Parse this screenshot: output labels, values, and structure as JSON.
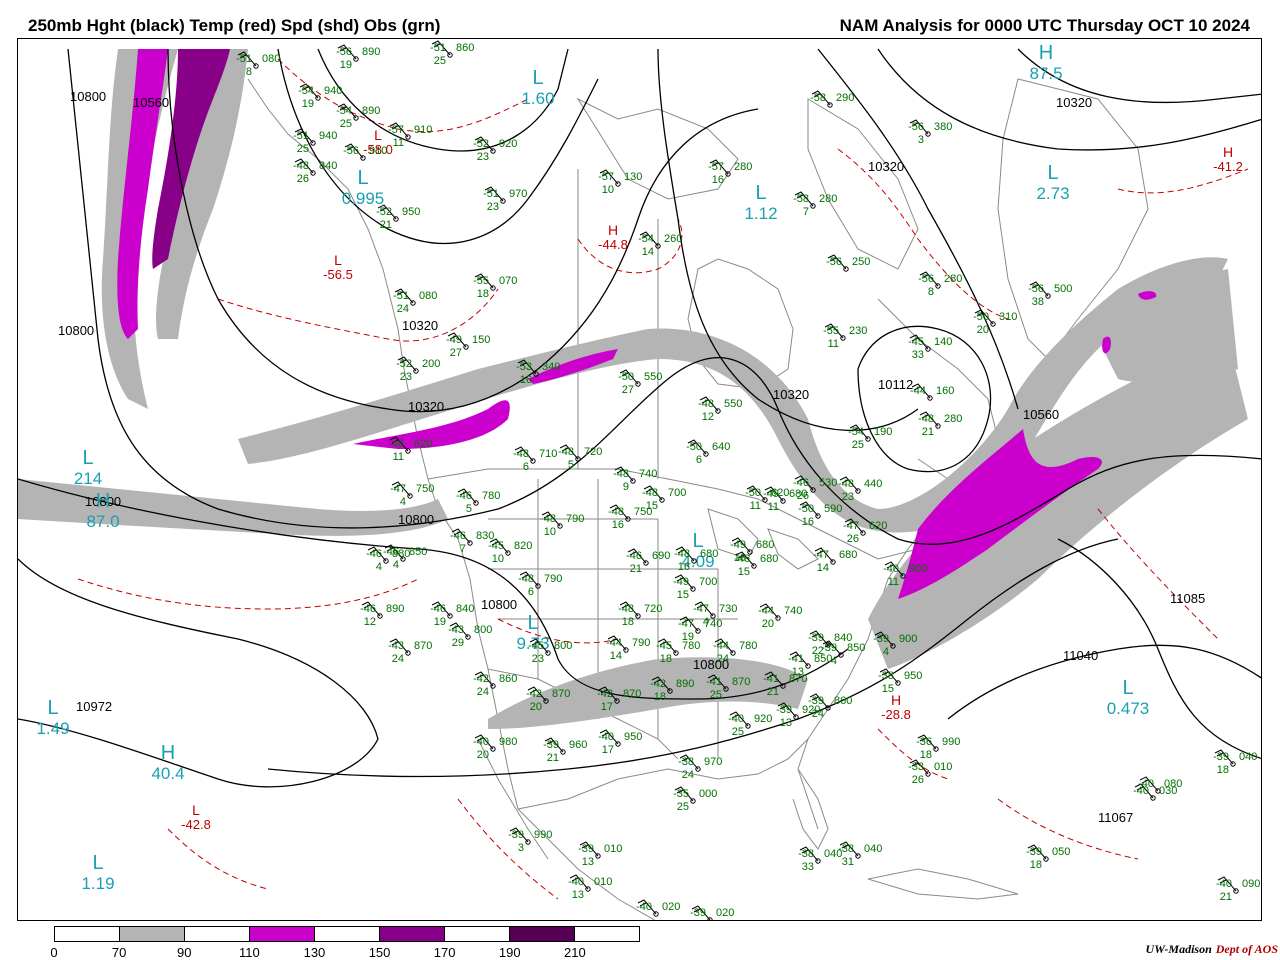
{
  "header": {
    "title_left": "250mb Hght (black) Temp (red) Spd (shd) Obs (grn)",
    "title_right": "NAM Analysis for 0000 UTC Thursday  OCT 10 2024"
  },
  "colors": {
    "height_contour": "#000000",
    "temperature_contour": "#c00000",
    "observations": "#007000",
    "pressure_centers": "#1aa0b0",
    "geography": "#888888",
    "speed_70_90": "#b4b4b4",
    "speed_110_130": "#cc00cc",
    "speed_150_170": "#880088",
    "speed_190_210": "#550055"
  },
  "legend": {
    "ticks": [
      "0",
      "70",
      "90",
      "110",
      "130",
      "150",
      "170",
      "190",
      "210"
    ],
    "fills": [
      "#ffffff",
      "#b4b4b4",
      "#ffffff",
      "#cc00cc",
      "#ffffff",
      "#880088",
      "#ffffff",
      "#550055",
      "#ffffff"
    ]
  },
  "credit": {
    "org": "UW-Madison",
    "dept": "Dept of AOS"
  },
  "height_labels": [
    {
      "text": "10800"
    },
    {
      "text": "10560"
    },
    {
      "text": "10800"
    },
    {
      "text": "10800"
    },
    {
      "text": "10320"
    },
    {
      "text": "10320"
    },
    {
      "text": "10320"
    },
    {
      "text": "10800"
    },
    {
      "text": "10320"
    },
    {
      "text": "10560"
    },
    {
      "text": "10800"
    },
    {
      "text": "10800"
    },
    {
      "text": "11040"
    },
    {
      "text": "10972"
    },
    {
      "text": "10112"
    },
    {
      "text": "11085"
    },
    {
      "text": "11067"
    },
    {
      "text": "10320"
    }
  ],
  "pressure_centers": [
    {
      "letter": "L",
      "value": "1.60"
    },
    {
      "letter": "L",
      "value": "0.995"
    },
    {
      "letter": "L",
      "value": "1.12"
    },
    {
      "letter": "L",
      "value": "2.73"
    },
    {
      "letter": "H",
      "value": "87.5"
    },
    {
      "letter": "L",
      "value": "214"
    },
    {
      "letter": "H",
      "value": "87.0"
    },
    {
      "letter": "L",
      "value": "4.09"
    },
    {
      "letter": "L",
      "value": "0.473"
    },
    {
      "letter": "H",
      "value": "40.4"
    },
    {
      "letter": "L",
      "value": "1.49"
    },
    {
      "letter": "L",
      "value": "1.19"
    },
    {
      "letter": "L",
      "value": "9.73"
    }
  ],
  "temperature_centers": [
    {
      "letter": "L",
      "value": "-56.5"
    },
    {
      "letter": "H",
      "value": "-44.8"
    },
    {
      "letter": "H",
      "value": "-41.2"
    },
    {
      "letter": "L",
      "value": "-42.8"
    },
    {
      "letter": "H",
      "value": "-28.8"
    },
    {
      "letter": "L",
      "value": "-58.0"
    }
  ],
  "observations": [
    {
      "t": "-56",
      "h": "890",
      "d": "19"
    },
    {
      "t": "-51",
      "h": "860",
      "d": "25"
    },
    {
      "t": "-51",
      "h": "080",
      "d": "8"
    },
    {
      "t": "-54",
      "h": "940",
      "d": "19"
    },
    {
      "t": "-54",
      "h": "890",
      "d": "25"
    },
    {
      "t": "-57",
      "h": "910",
      "d": "11"
    },
    {
      "t": "-51",
      "h": "940",
      "d": "25"
    },
    {
      "t": "-52",
      "h": "920",
      "d": "23"
    },
    {
      "t": "-56",
      "h": "910",
      "d": ""
    },
    {
      "t": "-48",
      "h": "840",
      "d": "26"
    },
    {
      "t": "-51",
      "h": "970",
      "d": "23"
    },
    {
      "t": "-57",
      "h": "130",
      "d": "10"
    },
    {
      "t": "-57",
      "h": "280",
      "d": "16"
    },
    {
      "t": "-58",
      "h": "290",
      "d": ""
    },
    {
      "t": "-56",
      "h": "380",
      "d": "3"
    },
    {
      "t": "-52",
      "h": "950",
      "d": "21"
    },
    {
      "t": "-58",
      "h": "280",
      "d": "7"
    },
    {
      "t": "-54",
      "h": "260",
      "d": "14"
    },
    {
      "t": "-56",
      "h": "250",
      "d": ""
    },
    {
      "t": "-55",
      "h": "070",
      "d": "18"
    },
    {
      "t": "-51",
      "h": "080",
      "d": "24"
    },
    {
      "t": "-56",
      "h": "280",
      "d": "8"
    },
    {
      "t": "-56",
      "h": "500",
      "d": "38"
    },
    {
      "t": "-50",
      "h": "310",
      "d": "20"
    },
    {
      "t": "-55",
      "h": "230",
      "d": "11"
    },
    {
      "t": "-45",
      "h": "140",
      "d": "33"
    },
    {
      "t": "-49",
      "h": "150",
      "d": "27"
    },
    {
      "t": "-52",
      "h": "200",
      "d": "23"
    },
    {
      "t": "-53",
      "h": "340",
      "d": "16"
    },
    {
      "t": "-50",
      "h": "550",
      "d": "27"
    },
    {
      "t": "-44",
      "h": "160",
      "d": ""
    },
    {
      "t": "-48",
      "h": "550",
      "d": "12"
    },
    {
      "t": "-48",
      "h": "280",
      "d": "21"
    },
    {
      "t": "-54",
      "h": "190",
      "d": "25"
    },
    {
      "t": "-48",
      "h": "620",
      "d": "11"
    },
    {
      "t": "-48",
      "h": "710",
      "d": "6"
    },
    {
      "t": "-48",
      "h": "720",
      "d": "5"
    },
    {
      "t": "-50",
      "h": "640",
      "d": "6"
    },
    {
      "t": "-48",
      "h": "740",
      "d": "9"
    },
    {
      "t": "-49",
      "h": "680",
      "d": "11"
    },
    {
      "t": "-47",
      "h": "750",
      "d": "4"
    },
    {
      "t": "-46",
      "h": "780",
      "d": "5"
    },
    {
      "t": "-48",
      "h": "700",
      "d": "15"
    },
    {
      "t": "-50",
      "h": "620",
      "d": "11"
    },
    {
      "t": "-46",
      "h": "530",
      "d": "26"
    },
    {
      "t": "-48",
      "h": "440",
      "d": "23"
    },
    {
      "t": "-50",
      "h": "590",
      "d": "16"
    },
    {
      "t": "-47",
      "h": "620",
      "d": "26"
    },
    {
      "t": "-48",
      "h": "790",
      "d": "10"
    },
    {
      "t": "-48",
      "h": "750",
      "d": "16"
    },
    {
      "t": "-46",
      "h": "850",
      "d": "4"
    },
    {
      "t": "-46",
      "h": "830",
      "d": "7"
    },
    {
      "t": "-45",
      "h": "820",
      "d": "10"
    },
    {
      "t": "-46",
      "h": "690",
      "d": "21"
    },
    {
      "t": "-48",
      "h": "680",
      "d": "16"
    },
    {
      "t": "-49",
      "h": "680",
      "d": "16"
    },
    {
      "t": "-46",
      "h": "680",
      "d": "15"
    },
    {
      "t": "-47",
      "h": "680",
      "d": "14"
    },
    {
      "t": "-46",
      "h": "880",
      "d": "4"
    },
    {
      "t": "-48",
      "h": "790",
      "d": "6"
    },
    {
      "t": "-49",
      "h": "700",
      "d": "15"
    },
    {
      "t": "-40",
      "h": "900",
      "d": "11"
    },
    {
      "t": "-46",
      "h": "890",
      "d": "12"
    },
    {
      "t": "-46",
      "h": "840",
      "d": "19"
    },
    {
      "t": "-48",
      "h": "720",
      "d": "18"
    },
    {
      "t": "-47",
      "h": "730",
      "d": "4"
    },
    {
      "t": "-47",
      "h": "740",
      "d": "19"
    },
    {
      "t": "-44",
      "h": "740",
      "d": "20"
    },
    {
      "t": "-39",
      "h": "840",
      "d": "22"
    },
    {
      "t": "-43",
      "h": "800",
      "d": "29"
    },
    {
      "t": "-45",
      "h": "800",
      "d": "23"
    },
    {
      "t": "-44",
      "h": "790",
      "d": "14"
    },
    {
      "t": "-45",
      "h": "780",
      "d": "18"
    },
    {
      "t": "-44",
      "h": "780",
      "d": "24"
    },
    {
      "t": "-41",
      "h": "850",
      "d": "13"
    },
    {
      "t": "-39",
      "h": "850",
      "d": "4"
    },
    {
      "t": "-39",
      "h": "900",
      "d": "4"
    },
    {
      "t": "-43",
      "h": "870",
      "d": "24"
    },
    {
      "t": "-42",
      "h": "860",
      "d": "24"
    },
    {
      "t": "-42",
      "h": "870",
      "d": "20"
    },
    {
      "t": "-42",
      "h": "870",
      "d": "17"
    },
    {
      "t": "-42",
      "h": "890",
      "d": "18"
    },
    {
      "t": "-41",
      "h": "870",
      "d": "25"
    },
    {
      "t": "-41",
      "h": "870",
      "d": "21"
    },
    {
      "t": "-39",
      "h": "860",
      "d": "24"
    },
    {
      "t": "-38",
      "h": "950",
      "d": "15"
    },
    {
      "t": "-40",
      "h": "920",
      "d": "25"
    },
    {
      "t": "-39",
      "h": "920",
      "d": "13"
    },
    {
      "t": "-40",
      "h": "980",
      "d": "20"
    },
    {
      "t": "-39",
      "h": "960",
      "d": "21"
    },
    {
      "t": "-40",
      "h": "950",
      "d": "17"
    },
    {
      "t": "-38",
      "h": "970",
      "d": "24"
    },
    {
      "t": "-36",
      "h": "990",
      "d": "18"
    },
    {
      "t": "-35",
      "h": "000",
      "d": "25"
    },
    {
      "t": "-33",
      "h": "010",
      "d": "26"
    },
    {
      "t": "-39",
      "h": "040",
      "d": "18"
    },
    {
      "t": "-40",
      "h": "030",
      "d": ""
    },
    {
      "t": "-39",
      "h": "990",
      "d": "3"
    },
    {
      "t": "-39",
      "h": "010",
      "d": "13"
    },
    {
      "t": "-38",
      "h": "040",
      "d": "33"
    },
    {
      "t": "-38",
      "h": "040",
      "d": "31"
    },
    {
      "t": "-39",
      "h": "050",
      "d": "18"
    },
    {
      "t": "-40",
      "h": "010",
      "d": "13"
    },
    {
      "t": "-40",
      "h": "020",
      "d": ""
    },
    {
      "t": "-39",
      "h": "020",
      "d": ""
    },
    {
      "t": "-40",
      "h": "090",
      "d": "21"
    },
    {
      "t": "-40",
      "h": "080",
      "d": ""
    }
  ]
}
